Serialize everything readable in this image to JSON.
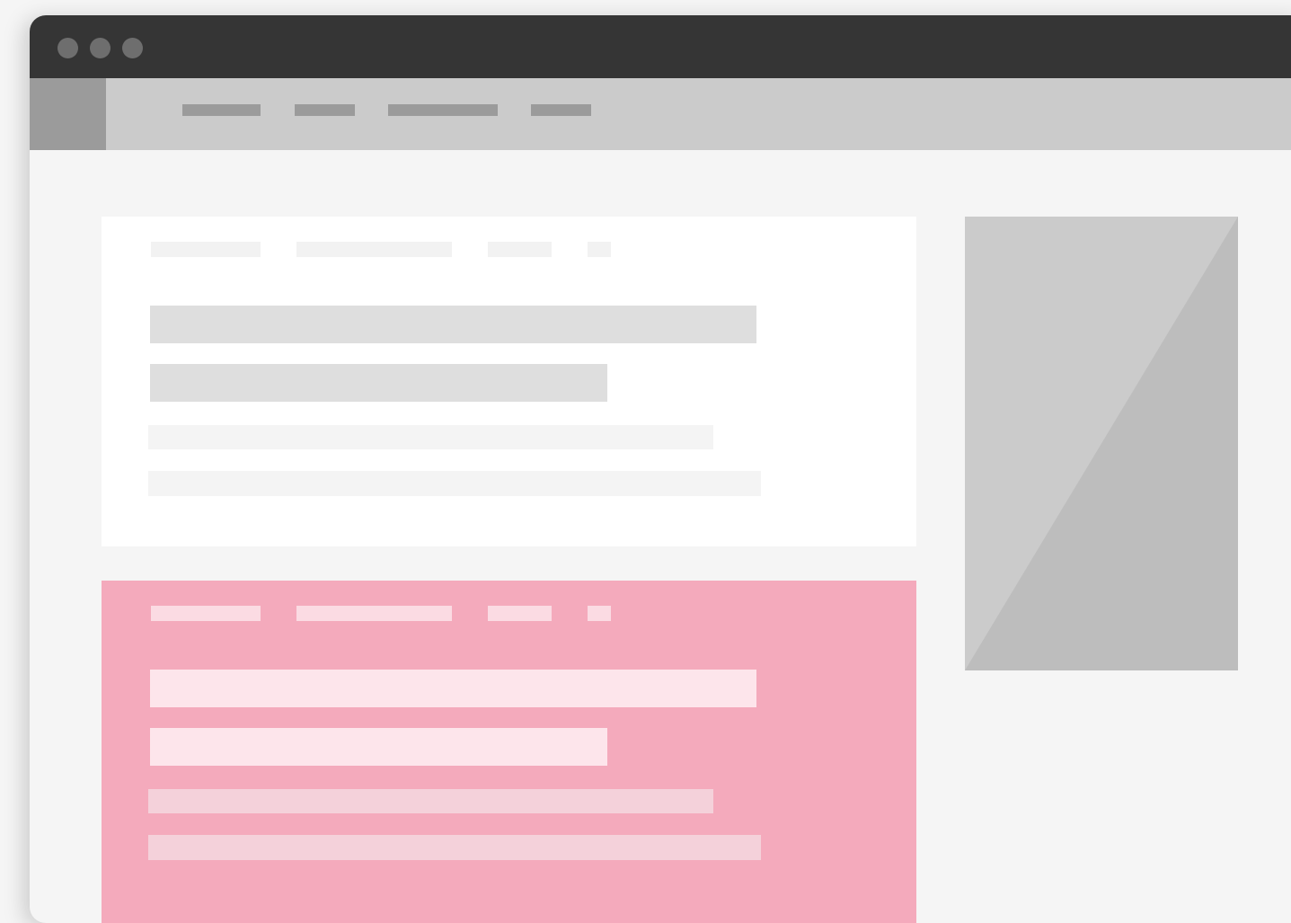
{
  "window": {
    "controls": [
      "window-control-dot",
      "window-control-dot",
      "window-control-dot"
    ]
  },
  "colors": {
    "titlebar": "#353535",
    "navbar": "#cbcbcb",
    "placeholder": "#9b9b9b",
    "content_bg": "#f5f5f5",
    "card_white": "#ffffff",
    "card_highlight": "#f4aabc",
    "image_placeholder": "#cbcbcb",
    "image_shade": "#bdbdbd"
  },
  "navbar": {
    "logo_icon": "logo-placeholder",
    "items": [
      "nav-item-1",
      "nav-item-2",
      "nav-item-3",
      "nav-item-4"
    ]
  },
  "main": {
    "cards": [
      {
        "style": "white"
      },
      {
        "style": "highlighted"
      }
    ]
  },
  "sidebar": {
    "image_icon": "image-placeholder-icon"
  }
}
